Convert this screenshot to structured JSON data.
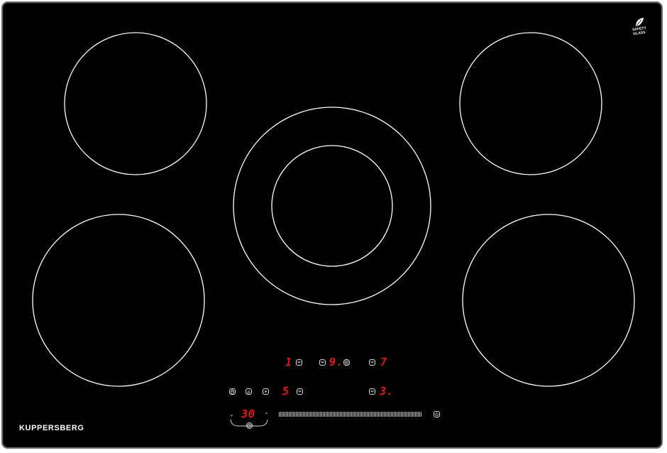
{
  "brand": {
    "name": "KUPPERSBERG"
  },
  "badge": {
    "line1": "SAFETY",
    "line2": "GLASS",
    "icon": "leaf-icon"
  },
  "colors": {
    "glass": "#000000",
    "frame": "#6d6d6d",
    "ring": "#ffffff",
    "display": "#ff1e1e"
  },
  "displays": {
    "top_left_level": "1",
    "top_center_level": "9.",
    "top_right_level": "7",
    "bottom_left_level": "5",
    "bottom_right_level": "3.",
    "timer": "30"
  },
  "icons": {
    "zone_top_left": "zone-select-icon",
    "zone_top_center": "zone-select-icon",
    "dual_zone": "dual-ring-icon",
    "zone_top_right": "zone-select-icon",
    "lock": "lock-icon",
    "keep_warm": "keep-warm-icon",
    "pause": "pause-icon",
    "zone_bottom_left": "zone-select-icon",
    "zone_bottom_right": "zone-select-icon",
    "timer": "clock-icon",
    "power": "power-icon",
    "timer_down": "chevron-down-icon",
    "timer_up": "chevron-up-icon"
  }
}
